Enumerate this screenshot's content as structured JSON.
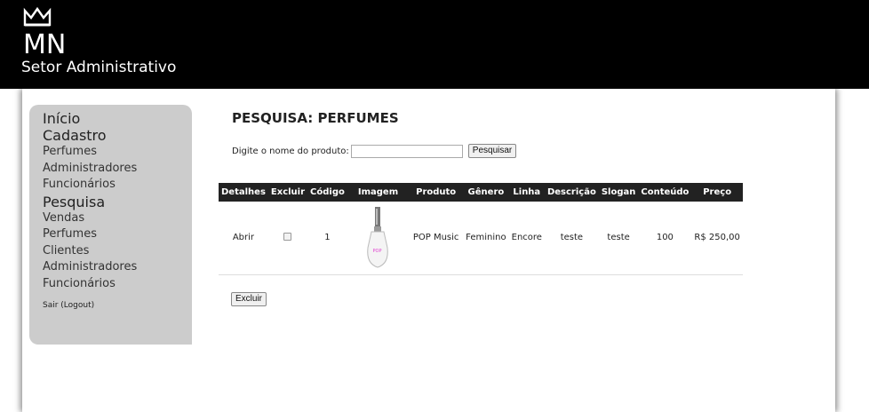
{
  "header": {
    "logo_text": "MN",
    "subtitle": "Setor Administrativo"
  },
  "sidebar": {
    "inicio": "Início",
    "cadastro": "Cadastro",
    "cadastro_items": [
      "Perfumes",
      "Administradores",
      "Funcionários"
    ],
    "pesquisa": "Pesquisa",
    "pesquisa_items": [
      "Vendas",
      "Perfumes",
      "Clientes",
      "Administradores",
      "Funcionários"
    ],
    "logout": "Sair (Logout)"
  },
  "main": {
    "title": "PESQUISA: PERFUMES",
    "search_label": "Digite o nome do produto:",
    "search_value": "",
    "search_button": "Pesquisar",
    "delete_button": "Excluir"
  },
  "table": {
    "headers": [
      "Detalhes",
      "Excluir",
      "Código",
      "Imagem",
      "Produto",
      "Gênero",
      "Linha",
      "Descrição",
      "Slogan",
      "Conteúdo",
      "Preço"
    ],
    "rows": [
      {
        "detalhes": "Abrir",
        "excluir_checked": false,
        "codigo": "1",
        "imagem_label": "POP",
        "produto": "POP Music",
        "genero": "Feminino",
        "linha": "Encore",
        "descricao": "teste",
        "slogan": "teste",
        "conteudo": "100",
        "preco": "R$ 250,00"
      }
    ]
  },
  "colors": {
    "header_bg": "#000000",
    "sidebar_bg": "#cccccc",
    "table_header_bg": "#222222"
  }
}
